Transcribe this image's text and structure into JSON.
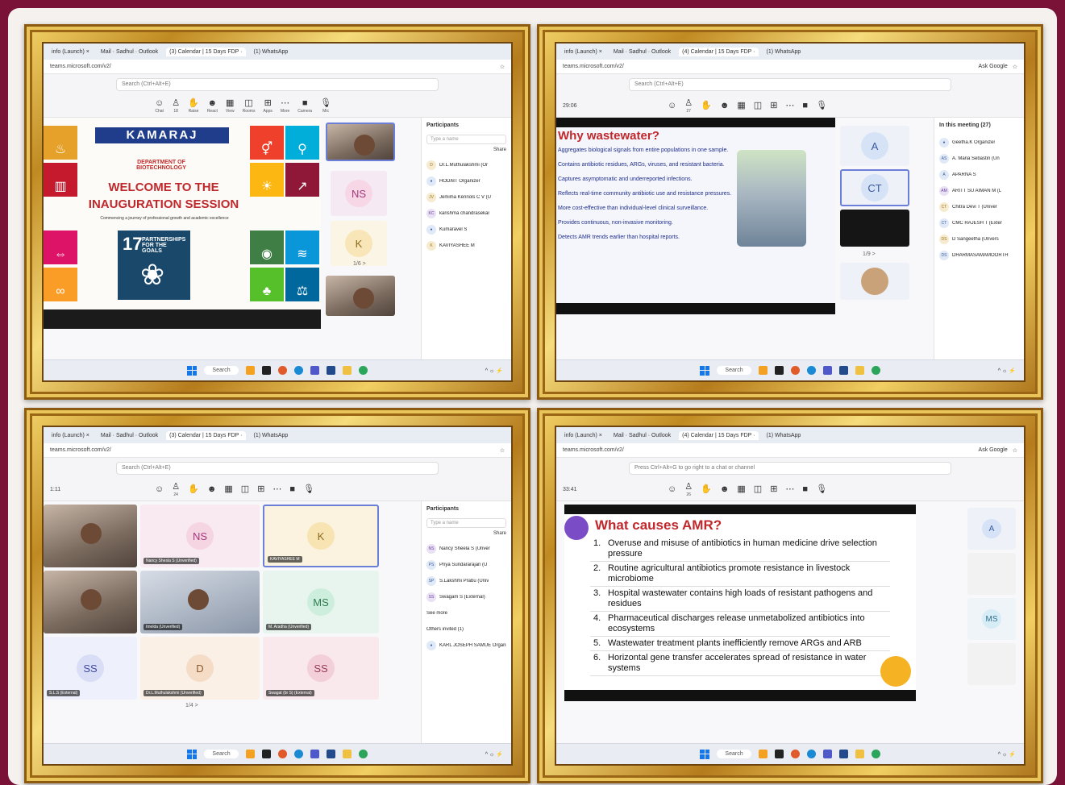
{
  "frames": [
    {
      "id": "top-left",
      "browser_tabs": [
        "info (Launch) ×",
        "Mail · Sadhul · Outlook",
        "(3) Calendar | 15 Days FDP ·",
        "(1) WhatsApp"
      ],
      "url": "teams.microsoft.com/v2/",
      "search_placeholder": "Search (Ctrl+Alt+E)",
      "toolbar": [
        "Chat",
        "People",
        "Raise",
        "React",
        "View",
        "Rooms",
        "Apps",
        "More",
        "Camera",
        "Mic"
      ],
      "people_count": "18",
      "slide": {
        "logo": "KAMARAJ",
        "dept": "DEPARTMENT OF BIOTECHNOLOGY",
        "welcome": "WELCOME TO THE INAUGURATION SESSION",
        "tagline": "Commencing a journey of professional growth and academic excellence",
        "sdg17": "PARTNERSHIPS FOR THE GOALS",
        "sdg17_num": "17"
      },
      "tiles": [
        "NS",
        "K"
      ],
      "pager": "1/6 >",
      "panel_title": "Participants",
      "panel_type": "Type a name",
      "panel_share": "Share",
      "participants": [
        {
          "init": "D",
          "name": "Dr.L.Muthulakshmi (Or"
        },
        {
          "init": "",
          "name": "HOD/BT Organizer"
        },
        {
          "init": "JV",
          "name": "Jemima Kennols C V (U"
        },
        {
          "init": "KC",
          "name": "karishma chandrasekar"
        },
        {
          "init": "",
          "name": "Kumaravel S"
        },
        {
          "init": "K",
          "name": "KAVIYASHEE M"
        }
      ],
      "taskbar_search": "Search"
    },
    {
      "id": "top-right",
      "browser_tabs": [
        "info (Launch) ×",
        "Mail · Sadhul · Outlook",
        "(4) Calendar | 15 Days FDP ·",
        "(1) WhatsApp"
      ],
      "url": "teams.microsoft.com/v2/",
      "ask_google": "Ask Google",
      "search_placeholder": "Search (Ctrl+Alt+E)",
      "meeting_time": "29:06",
      "people_count": "27",
      "slide": {
        "title": "Why wastewater?",
        "bullets": [
          "Aggregates biological signals from entire populations in one sample.",
          "Contains antibiotic residues, ARGs, viruses, and resistant bacteria.",
          "Captures asymptomatic and underreported infections.",
          "Reflects real-time community antibiotic use and resistance pressures.",
          "More cost-effective than individual-level clinical surveillance.",
          "Provides continuous, non-invasive monitoring.",
          "Detects AMR trends earlier than hospital reports."
        ]
      },
      "tiles": [
        "A",
        "CT"
      ],
      "pager": "1/9 >",
      "panel_title": "In this meeting (27)",
      "participants": [
        {
          "init": "",
          "name": "Geetha.K Organizer"
        },
        {
          "init": "AS",
          "name": "A. Maria Sebastin (Un"
        },
        {
          "init": "A",
          "name": "APARNA S"
        },
        {
          "init": "AM",
          "name": "ARITT SU AIMAN M (L"
        },
        {
          "init": "CT",
          "name": "Chitra Devi T (Univer"
        },
        {
          "init": "CT",
          "name": "CMC RAJESH T (Exter"
        },
        {
          "init": "DS",
          "name": "D Sangeetha (Unvers"
        },
        {
          "init": "DS",
          "name": "DHARMASAMAMOORTH"
        }
      ],
      "taskbar_search": "Search"
    },
    {
      "id": "bottom-left",
      "browser_tabs": [
        "info (Launch) ×",
        "Mail · Sadhul · Outlook",
        "(3) Calendar | 15 Days FDP ·",
        "(1) WhatsApp"
      ],
      "url": "teams.microsoft.com/v2/",
      "search_placeholder": "Search (Ctrl+Alt+E)",
      "meeting_time": "1:11",
      "people_count": "24",
      "tiles": [
        {
          "init": "",
          "label": ""
        },
        {
          "init": "NS",
          "label": "Nancy Shesla S (Unverified)"
        },
        {
          "init": "K",
          "label": "KAVIYASHEE M"
        },
        {
          "init": "",
          "label": ""
        },
        {
          "init": "",
          "label": "Imelda (Unverified)"
        },
        {
          "init": "MS",
          "label": "M. Aradha (Unverified)"
        },
        {
          "init": "SS",
          "label": "S.L.S (External)"
        },
        {
          "init": "D",
          "label": "Dr.L.Muthulakshmi (Unverified)"
        },
        {
          "init": "SS",
          "label": "Swagat (br S) (External)"
        }
      ],
      "pager": "1/4 >",
      "panel_title": "Participants",
      "panel_type": "Type a name",
      "panel_share": "Share",
      "participants": [
        {
          "init": "NS",
          "name": "Nancy Sheela S (Unver"
        },
        {
          "init": "PS",
          "name": "Priya Sundararajan (U"
        },
        {
          "init": "SP",
          "name": "S.Lakshmi Prabu (Univ"
        },
        {
          "init": "SS",
          "name": "Swagam S (External)"
        }
      ],
      "see_more": "See more",
      "others_invited": "Others invited (1)",
      "invited": "KARL JOSEPH SAMUE Organizer",
      "taskbar_search": "Search"
    },
    {
      "id": "bottom-right",
      "browser_tabs": [
        "info (Launch) ×",
        "Mail · Sadhul · Outlook",
        "(4) Calendar | 15 Days FDP ·",
        "(1) WhatsApp"
      ],
      "url": "teams.microsoft.com/v2/",
      "ask_google": "Ask Google",
      "search_placeholder": "Press Ctrl+Alt+G to go right to a chat or channel",
      "meeting_time": "33:41",
      "people_count": "26",
      "slide": {
        "title": "What causes AMR?",
        "items": [
          {
            "n": "1.",
            "text": "Overuse and misuse of antibiotics in human medicine drive selection pressure"
          },
          {
            "n": "2.",
            "text": "Routine agricultural antibiotics promote resistance in livestock microbiome"
          },
          {
            "n": "3.",
            "text": "Hospital wastewater contains high loads of resistant pathogens and residues"
          },
          {
            "n": "4.",
            "text": "Pharmaceutical discharges release unmetabolized antibiotics into ecosystems"
          },
          {
            "n": "5.",
            "text": "Wastewater treatment plants inefficiently remove ARGs and ARB"
          },
          {
            "n": "6.",
            "text": "Horizontal gene transfer accelerates spread of resistance in water systems"
          }
        ]
      },
      "tiles": [
        "A",
        "MS"
      ],
      "taskbar_search": "Search"
    }
  ],
  "colors": {
    "backdrop": "#7a1238",
    "gold": "#c08a22",
    "amr_red": "#c0282c",
    "why_red": "#c0282c"
  }
}
